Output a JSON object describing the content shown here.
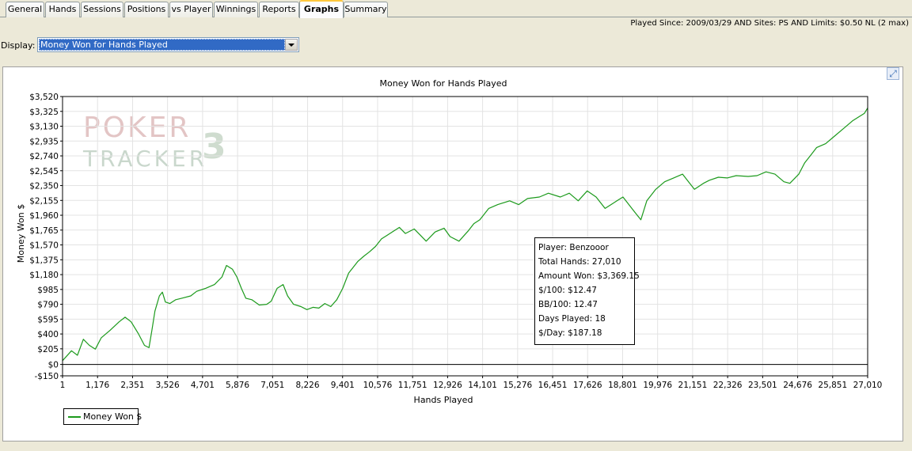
{
  "tabs": [
    {
      "label": "General"
    },
    {
      "label": "Hands"
    },
    {
      "label": "Sessions"
    },
    {
      "label": "Positions"
    },
    {
      "label": "vs Player"
    },
    {
      "label": "Winnings"
    },
    {
      "label": "Reports"
    },
    {
      "label": "Graphs",
      "active": true
    },
    {
      "label": "Summary"
    }
  ],
  "filter_text": "Played Since: 2009/03/29 AND Sites: PS AND Limits: $0.50 NL (2 max)",
  "display": {
    "label": "Display:",
    "value": "Money Won for Hands Played"
  },
  "watermark": {
    "line1": "POKER",
    "line2": "TRACKER",
    "number": "3"
  },
  "tooltip": {
    "player": "Player: Benzooor",
    "total_hands": "Total Hands: 27,010",
    "amount_won": "Amount Won: $3,369.15",
    "per100": "$/100: $12.47",
    "bb100": "BB/100: 12.47",
    "days_played": "Days Played: 18",
    "per_day": "$/Day: $187.18"
  },
  "chart_data": {
    "type": "line",
    "title": "Money Won for Hands Played",
    "xlabel": "Hands Played",
    "ylabel": "Money Won $",
    "xlim": [
      1,
      27010
    ],
    "ylim": [
      -150,
      3520
    ],
    "x_ticks": [
      "1",
      "1,176",
      "2,351",
      "3,526",
      "4,701",
      "5,876",
      "7,051",
      "8,226",
      "9,401",
      "10,576",
      "11,751",
      "12,926",
      "14,101",
      "15,276",
      "16,451",
      "17,626",
      "18,801",
      "19,976",
      "21,151",
      "22,326",
      "23,501",
      "24,676",
      "25,851",
      "27,010"
    ],
    "y_ticks": [
      "$3,520",
      "$3,325",
      "$3,130",
      "$2,935",
      "$2,740",
      "$2,545",
      "$2,350",
      "$2,155",
      "$1,960",
      "$1,765",
      "$1,570",
      "$1,375",
      "$1,180",
      "$985",
      "$790",
      "$595",
      "$400",
      "$205",
      "$0",
      "-$150"
    ],
    "y_tick_values": [
      3520,
      3325,
      3130,
      2935,
      2740,
      2545,
      2350,
      2155,
      1960,
      1765,
      1570,
      1375,
      1180,
      985,
      790,
      595,
      400,
      205,
      0,
      -150
    ],
    "grid": true,
    "legend_position": "bottom-left",
    "series": [
      {
        "name": "Money Won $",
        "color": "#1c9a1c",
        "x": [
          1,
          300,
          500,
          700,
          900,
          1100,
          1300,
          1600,
          1900,
          2100,
          2300,
          2550,
          2750,
          2900,
          3000,
          3100,
          3250,
          3350,
          3450,
          3600,
          3800,
          4000,
          4300,
          4500,
          4800,
          5100,
          5350,
          5500,
          5700,
          5850,
          6000,
          6150,
          6350,
          6600,
          6850,
          7000,
          7200,
          7400,
          7550,
          7750,
          8000,
          8200,
          8400,
          8600,
          8800,
          9000,
          9200,
          9400,
          9600,
          9800,
          9900,
          10100,
          10300,
          10500,
          10700,
          10900,
          11100,
          11300,
          11500,
          11800,
          12000,
          12200,
          12500,
          12800,
          13000,
          13300,
          13600,
          13800,
          14000,
          14300,
          14600,
          15000,
          15300,
          15600,
          16000,
          16300,
          16700,
          17000,
          17300,
          17600,
          17900,
          18200,
          18400,
          18600,
          18800,
          19000,
          19200,
          19400,
          19600,
          19900,
          20200,
          20500,
          20800,
          21000,
          21200,
          21500,
          21700,
          22000,
          22300,
          22600,
          23000,
          23300,
          23600,
          23900,
          24200,
          24400,
          24700,
          24900,
          25100,
          25300,
          25600,
          25900,
          26200,
          26500,
          26700,
          26900,
          27010
        ],
        "y": [
          50,
          180,
          120,
          330,
          250,
          200,
          350,
          450,
          560,
          620,
          560,
          400,
          250,
          220,
          450,
          700,
          900,
          950,
          820,
          800,
          850,
          870,
          900,
          960,
          1000,
          1050,
          1150,
          1300,
          1250,
          1150,
          1000,
          870,
          850,
          780,
          790,
          830,
          1000,
          1050,
          900,
          790,
          760,
          720,
          750,
          740,
          800,
          760,
          850,
          1000,
          1200,
          1300,
          1350,
          1420,
          1480,
          1550,
          1650,
          1700,
          1750,
          1800,
          1720,
          1780,
          1700,
          1620,
          1740,
          1790,
          1680,
          1620,
          1750,
          1850,
          1900,
          2050,
          2100,
          2150,
          2100,
          2180,
          2200,
          2250,
          2200,
          2250,
          2150,
          2280,
          2200,
          2050,
          2100,
          2150,
          2200,
          2100,
          2000,
          1900,
          2150,
          2300,
          2400,
          2450,
          2500,
          2400,
          2300,
          2380,
          2420,
          2460,
          2450,
          2480,
          2470,
          2480,
          2530,
          2500,
          2400,
          2380,
          2500,
          2650,
          2750,
          2850,
          2900,
          3000,
          3100,
          3200,
          3250,
          3300,
          3369
        ]
      }
    ]
  }
}
